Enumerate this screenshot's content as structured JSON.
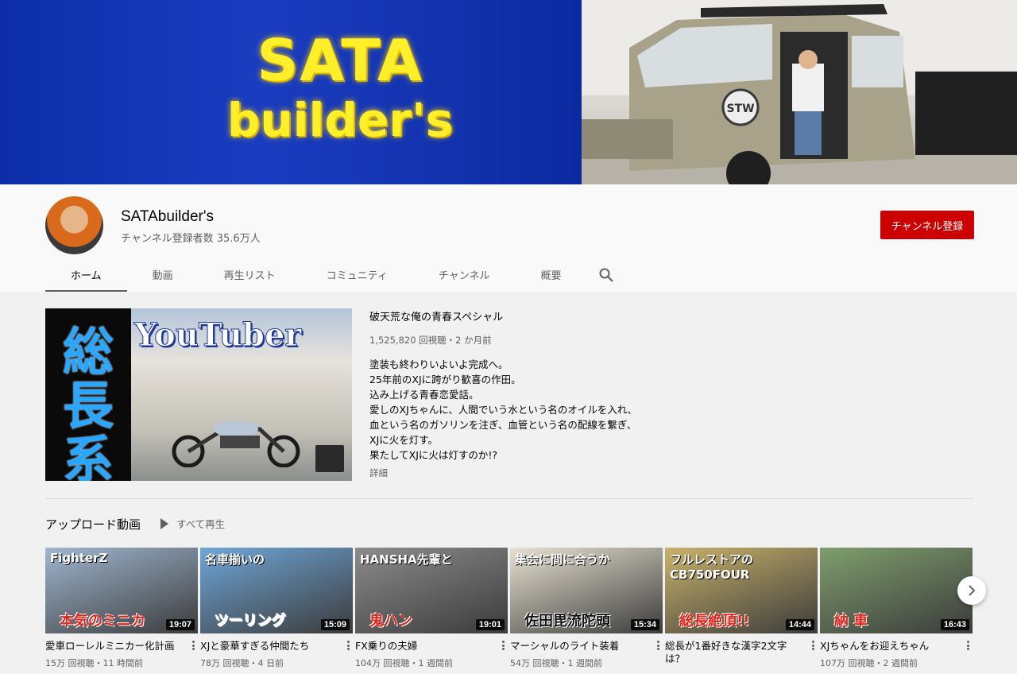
{
  "banner": {
    "line1": "SATA",
    "line2": "builder's"
  },
  "channel": {
    "name": "SATAbuilder's",
    "subscribers": "チャンネル登録者数 35.6万人",
    "subscribe_label": "チャンネル登録"
  },
  "tabs": [
    {
      "label": "ホーム"
    },
    {
      "label": "動画"
    },
    {
      "label": "再生リスト"
    },
    {
      "label": "コミュニティ"
    },
    {
      "label": "チャンネル"
    },
    {
      "label": "概要"
    }
  ],
  "featured": {
    "thumb_word": "YouTuber",
    "thumb_kanji": [
      "総",
      "長",
      "系"
    ],
    "title": "破天荒な俺の青春スペシャル",
    "meta": "1,525,820 回視聴・2 か月前",
    "description": [
      "塗装も終わりいよいよ完成へ。",
      "25年前のXJに跨がり歓喜の作田。",
      "込み上げる青春恋愛話。",
      "愛しのXJちゃんに、人間でいう水という名のオイルを入れ、",
      "血という名のガソリンを注ぎ、血管という名の配線を繋ぎ、",
      "XJに火を灯す。",
      "果たしてXJに火は灯すのか!?"
    ],
    "more_label": "詳細"
  },
  "uploads": {
    "title": "アップロード動画",
    "play_all": "すべて再生",
    "videos": [
      {
        "title": "愛車ローレルミニカー化計画",
        "meta": "15万 回視聴・11 時間前",
        "duration": "19:07",
        "caption": "本気のミニカ",
        "caption_top": "FighterZ",
        "bg": "#9fb6cf",
        "accent": "#e2231a"
      },
      {
        "title": "XJと豪華すぎる仲間たち",
        "meta": "78万 回視聴・4 日前",
        "duration": "15:09",
        "caption": "ツーリング",
        "caption_top": "名車揃いの",
        "bg": "#6fa6d8",
        "accent": "#ffffff"
      },
      {
        "title": "FX乗りの夫婦",
        "meta": "104万 回視聴・1 週間前",
        "duration": "19:01",
        "caption": "鬼ハン",
        "caption_top": "HANSHA先輩と",
        "bg": "#8c8c8c",
        "accent": "#e2231a"
      },
      {
        "title": "マーシャルのライト装着",
        "meta": "54万 回視聴・1 週間前",
        "duration": "15:34",
        "caption": "佐田毘流陀頭",
        "caption_top": "集会に間に合うか",
        "bg": "#e8e2d2",
        "accent": "#111111"
      },
      {
        "title": "総長が1番好きな漢字2文字は？",
        "meta": "",
        "duration": "14:44",
        "caption": "総長絶頂!!",
        "caption_top": "フルレストアの CB750FOUR",
        "bg": "#c9b26a",
        "accent": "#e2231a"
      },
      {
        "title": "XJちゃんをお迎えちゃん",
        "meta": "107万 回視聴・2 週間前",
        "duration": "16:43",
        "caption": "納 車",
        "caption_top": "",
        "bg": "#7f9e6d",
        "accent": "#e2231a"
      }
    ]
  },
  "colors": {
    "brand_red": "#cc0000",
    "banner_blue": "#1537b5",
    "banner_yellow": "#ffef2a"
  },
  "icons": [
    "search-icon",
    "play-all-icon",
    "more-vert-icon",
    "chevron-right-icon"
  ]
}
